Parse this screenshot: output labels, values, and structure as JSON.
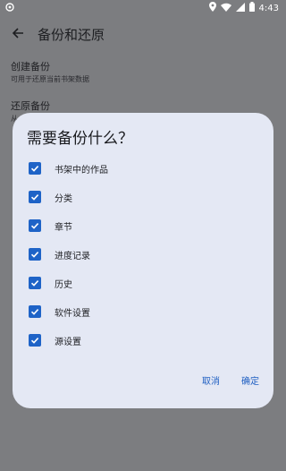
{
  "status_bar": {
    "time": "4:43",
    "left_icon": "app-notification-icon",
    "icons": [
      "location-icon",
      "wifi-icon",
      "signal-icon",
      "battery-icon"
    ]
  },
  "app_bar": {
    "back_icon": "arrow-back-icon",
    "title": "备份和还原"
  },
  "settings": [
    {
      "title": "创建备份",
      "subtitle": "可用于还原当前书架数据"
    },
    {
      "title": "还原备份",
      "subtitle": "从"
    }
  ],
  "dialog": {
    "title": "需要备份什么？",
    "options": [
      {
        "label": "书架中的作品",
        "checked": true
      },
      {
        "label": "分类",
        "checked": true
      },
      {
        "label": "章节",
        "checked": true
      },
      {
        "label": "进度记录",
        "checked": true
      },
      {
        "label": "历史",
        "checked": true
      },
      {
        "label": "软件设置",
        "checked": true
      },
      {
        "label": "源设置",
        "checked": true
      }
    ],
    "cancel_label": "取消",
    "confirm_label": "确定"
  },
  "colors": {
    "scrim": "#7c7d80",
    "dialog_bg": "#e4e8f4",
    "accent": "#1e63c7"
  }
}
